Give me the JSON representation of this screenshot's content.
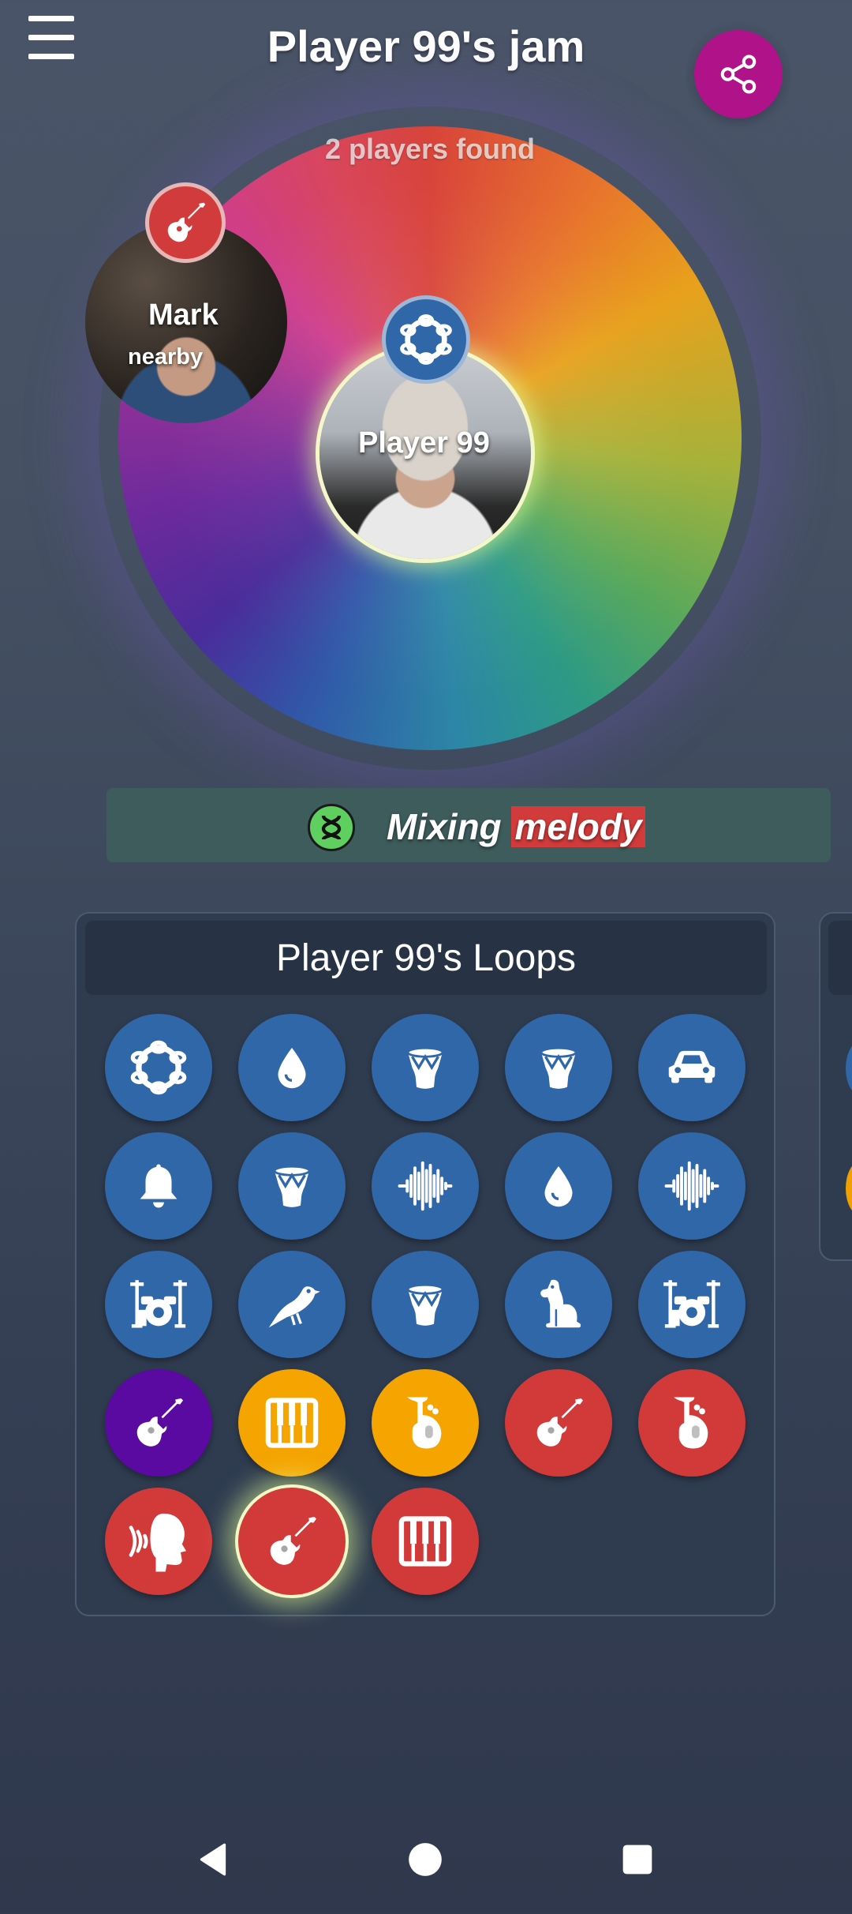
{
  "header": {
    "title": "Player 99's jam",
    "menu_icon": "hamburger-menu-icon",
    "share_icon": "share-icon"
  },
  "wheel": {
    "players_found": "2 players found"
  },
  "players": [
    {
      "name": "Mark",
      "status": "nearby",
      "instrument_icon": "guitar-icon",
      "badge_color": "#d23b3b"
    },
    {
      "name": "Player 99",
      "instrument_icon": "tambourine-icon",
      "badge_color": "#3067a8"
    }
  ],
  "mixing": {
    "label": "Mixing",
    "highlight": "melody",
    "icon": "mix-icon"
  },
  "loops": {
    "title": "Player 99's Loops",
    "items": [
      {
        "icon": "tambourine-icon",
        "color": "#3067a8"
      },
      {
        "icon": "water-drop-icon",
        "color": "#3067a8"
      },
      {
        "icon": "drum-icon",
        "color": "#3067a8"
      },
      {
        "icon": "drum-icon",
        "color": "#3067a8"
      },
      {
        "icon": "car-icon",
        "color": "#3067a8"
      },
      {
        "icon": "bell-icon",
        "color": "#3067a8"
      },
      {
        "icon": "drum-icon",
        "color": "#3067a8"
      },
      {
        "icon": "waveform-icon",
        "color": "#3067a8"
      },
      {
        "icon": "water-drop-icon",
        "color": "#3067a8"
      },
      {
        "icon": "waveform-icon",
        "color": "#3067a8"
      },
      {
        "icon": "drum-kit-icon",
        "color": "#3067a8"
      },
      {
        "icon": "bird-icon",
        "color": "#3067a8"
      },
      {
        "icon": "drum-icon",
        "color": "#3067a8"
      },
      {
        "icon": "dog-icon",
        "color": "#3067a8"
      },
      {
        "icon": "drum-kit-icon",
        "color": "#3067a8"
      },
      {
        "icon": "guitar-icon",
        "color": "#5a0aa0"
      },
      {
        "icon": "piano-keys-icon",
        "color": "#f5a400"
      },
      {
        "icon": "tuba-icon",
        "color": "#f5a400"
      },
      {
        "icon": "guitar-icon",
        "color": "#d23a3a"
      },
      {
        "icon": "tuba-icon",
        "color": "#d23a3a"
      },
      {
        "icon": "voice-icon",
        "color": "#d23a3a"
      },
      {
        "icon": "guitar-icon",
        "color": "#d23a3a",
        "active": true
      },
      {
        "icon": "piano-keys-icon",
        "color": "#d23a3a"
      }
    ]
  },
  "nav": {
    "back_icon": "back-icon",
    "home_icon": "home-icon",
    "recents_icon": "recents-icon"
  }
}
